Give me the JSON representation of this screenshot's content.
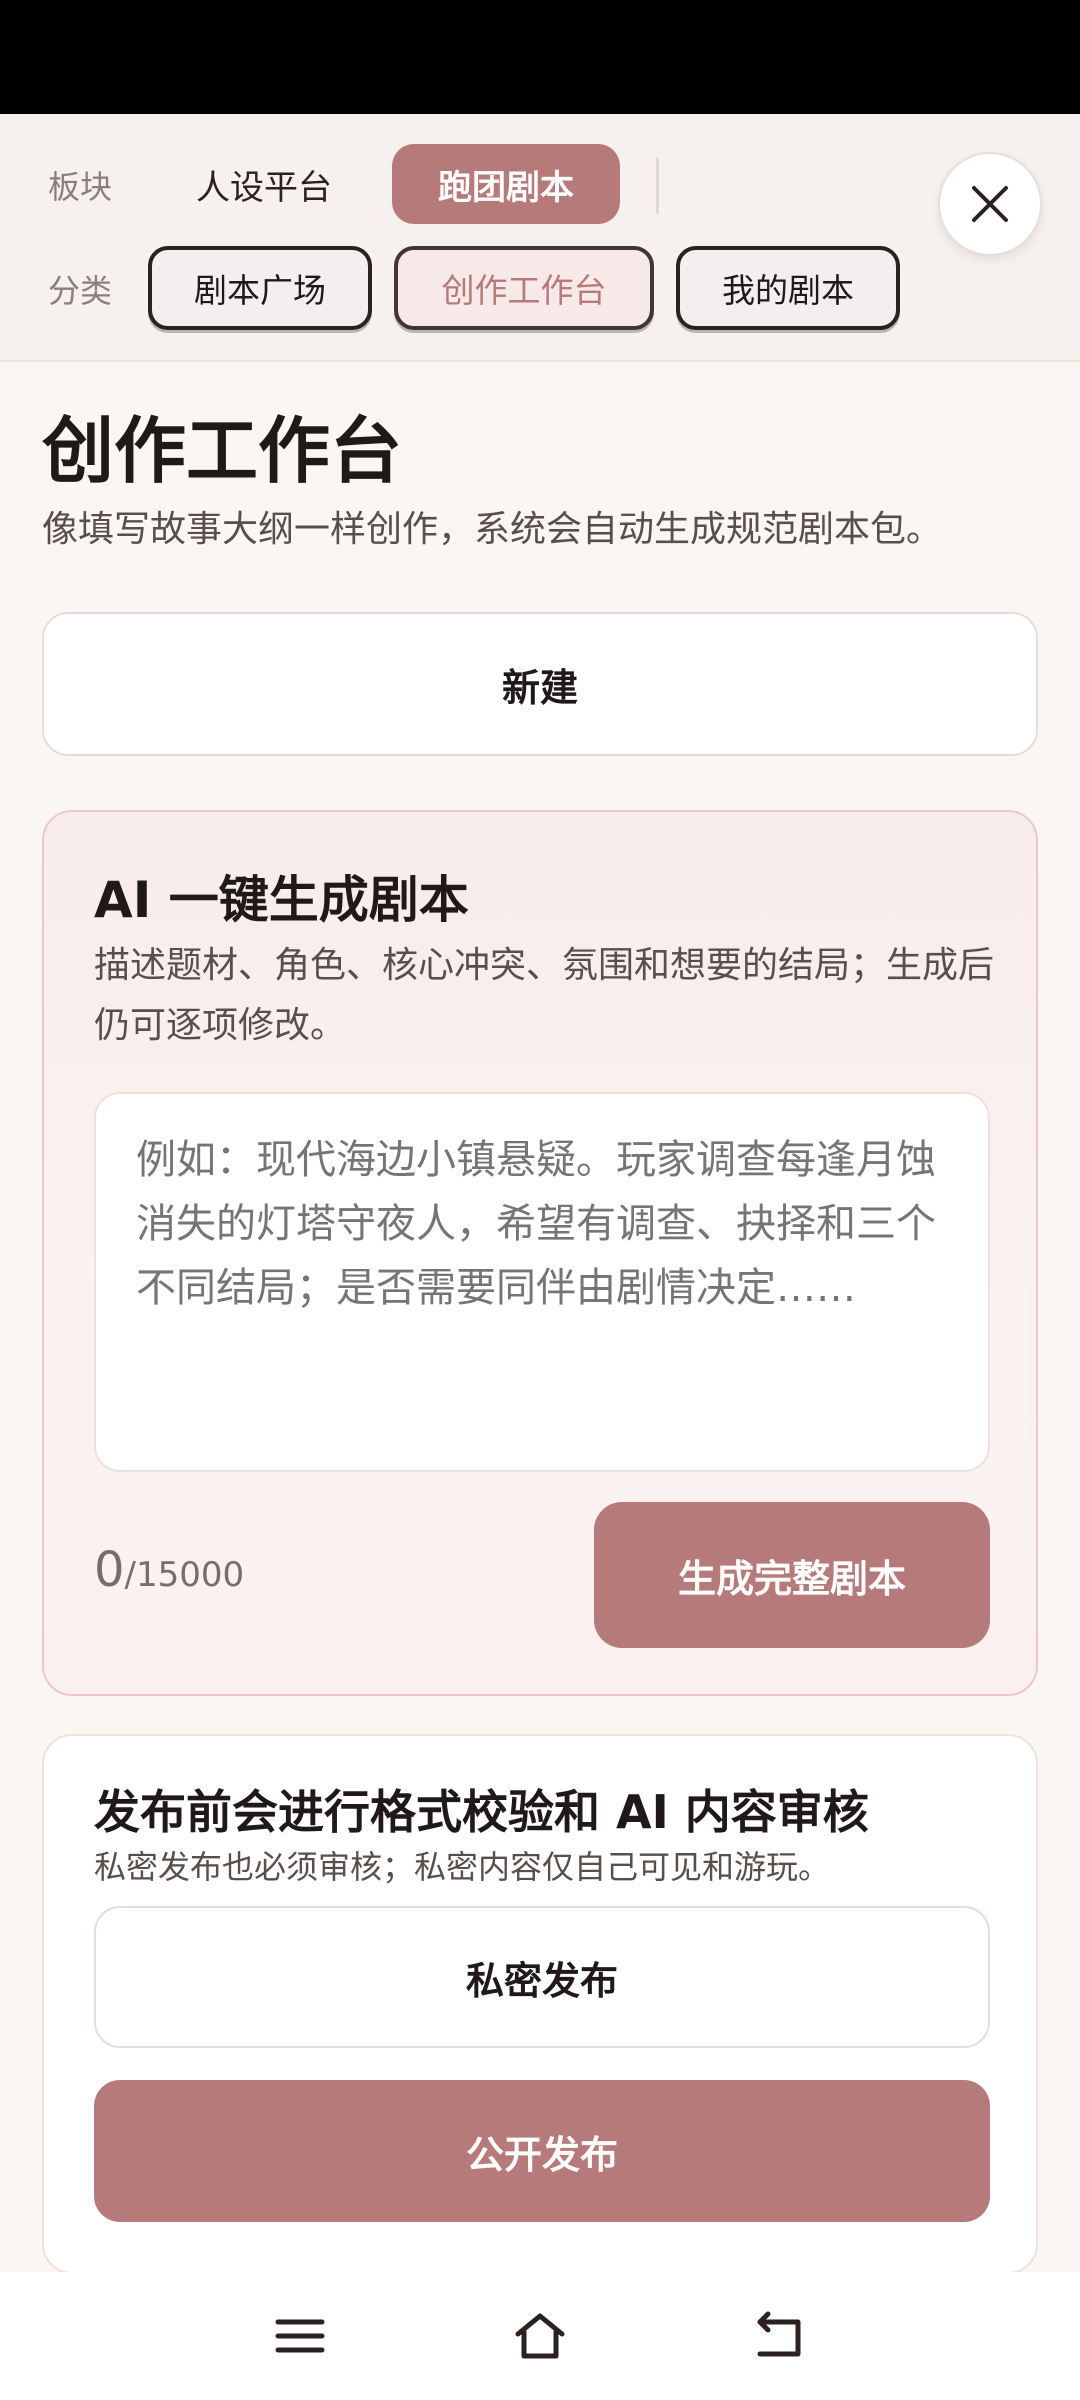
{
  "top_nav": {
    "board_label": "板块",
    "board_tabs": [
      {
        "label": "人设平台",
        "active": false
      },
      {
        "label": "跑团剧本",
        "active": true
      }
    ],
    "category_label": "分类",
    "category_tabs": [
      {
        "label": "剧本广场",
        "selected": false
      },
      {
        "label": "创作工作台",
        "selected": true
      },
      {
        "label": "我的剧本",
        "selected": false
      }
    ],
    "close_icon": "close-icon"
  },
  "page": {
    "title": "创作工作台",
    "description": "像填写故事大纲一样创作，系统会自动生成规范剧本包。"
  },
  "new_button": "新建",
  "ai_card": {
    "title": "AI 一键生成剧本",
    "description": "描述题材、角色、核心冲突、氛围和想要的结局；生成后仍可逐项修改。",
    "placeholder": "例如：现代海边小镇悬疑。玩家调查每逢月蚀消失的灯塔守夜人，希望有调查、抉择和三个不同结局；是否需要同伴由剧情决定……",
    "count": "0",
    "max": "/15000",
    "generate_button": "生成完整剧本"
  },
  "publish_card": {
    "title": "发布前会进行格式校验和 AI 内容审核",
    "description": "私密发布也必须审核；私密内容仅自己可见和游玩。",
    "private_button": "私密发布",
    "public_button": "公开发布"
  },
  "colors": {
    "accent": "#b77a7a",
    "background": "#faf6f4"
  },
  "system_nav": {
    "icons": [
      "menu-icon",
      "home-icon",
      "back-icon"
    ]
  }
}
